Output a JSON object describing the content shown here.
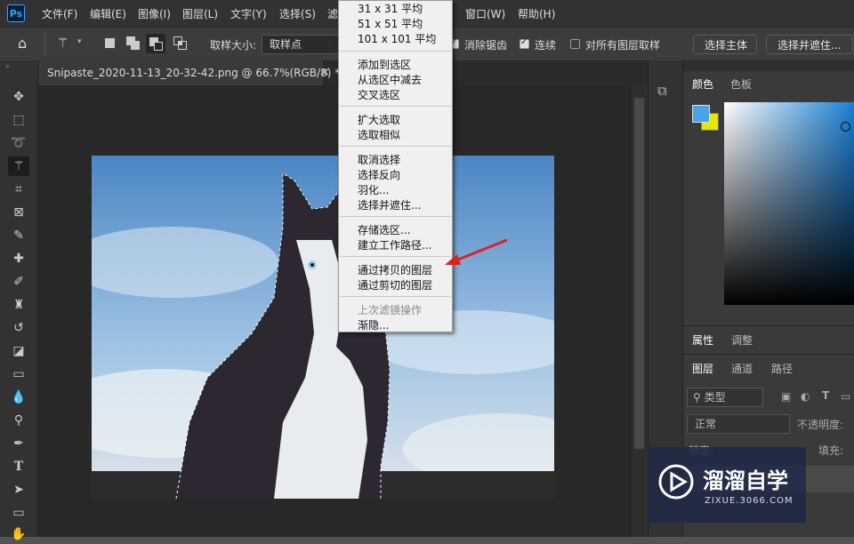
{
  "app": {
    "logo": "Ps"
  },
  "menubar": {
    "items": [
      "文件(F)",
      "编辑(E)",
      "图像(I)",
      "图层(L)",
      "文字(Y)",
      "选择(S)",
      "滤",
      "窗口(W)",
      "帮助(H)"
    ]
  },
  "options": {
    "sample_size_label": "取样大小:",
    "sample_size_value": "取样点",
    "antialias_label": "消除锯齿",
    "contiguous_label": "连续",
    "all_layers_label": "对所有图层取样",
    "select_subject": "选择主体",
    "select_and_mask": "选择并遮住..."
  },
  "document": {
    "tab_title": "Snipaste_2020-11-13_20-32-42.png @ 66.7%(RGB/8) *",
    "close": "×"
  },
  "dropdown": {
    "groups": [
      [
        "31 x 31 平均",
        "51 x 51 平均",
        "101 x 101 平均"
      ],
      [
        "添加到选区",
        "从选区中减去",
        "交叉选区"
      ],
      [
        "扩大选取",
        "选取相似"
      ],
      [
        "取消选择",
        "选择反向",
        "羽化...",
        "选择并遮住..."
      ],
      [
        "存储选区...",
        "建立工作路径..."
      ],
      [
        "通过拷贝的图层",
        "通过剪切的图层"
      ],
      [
        "上次滤镜操作",
        "渐隐..."
      ]
    ],
    "disabled": [
      "上次滤镜操作"
    ]
  },
  "right_panel": {
    "color_tabs": [
      "颜色",
      "色板"
    ],
    "prop_tabs": [
      "属性",
      "调整"
    ],
    "layer_tabs": [
      "图层",
      "通道",
      "路径"
    ],
    "kind_label": "类型",
    "blend_mode": "正常",
    "opacity_label": "不透明度:",
    "lock_label": "锁定:",
    "fill_label": "填充:"
  },
  "colors": {
    "foreground": "#4aa3e6",
    "background": "#e6e600",
    "accent_arrow": "#e02020"
  },
  "watermark": {
    "title": "溜溜自学",
    "subtitle": "ZIXUE.3066.COM"
  }
}
